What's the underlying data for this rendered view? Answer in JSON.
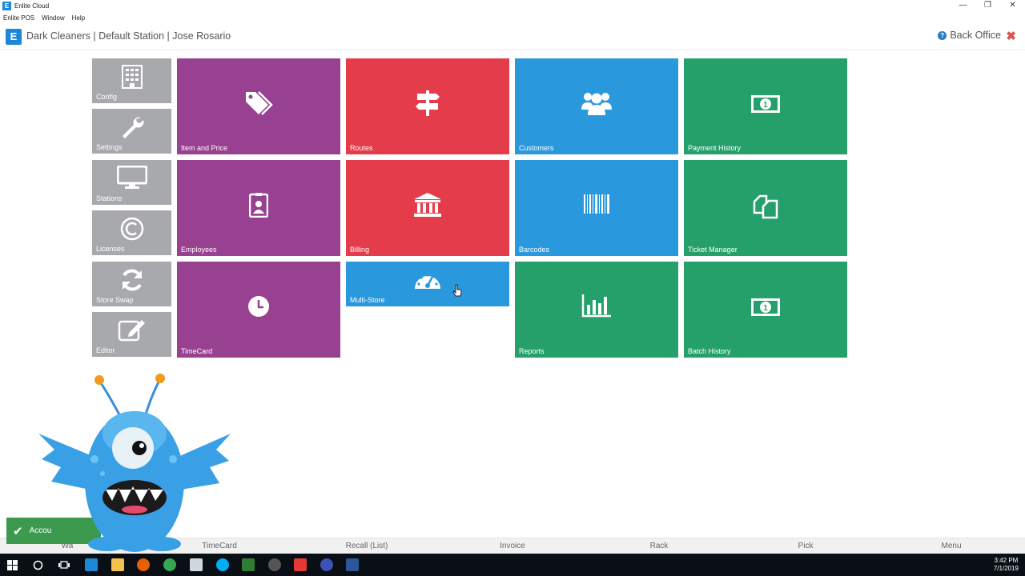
{
  "window": {
    "title": "Enlite Cloud",
    "app_icon_letter": "E",
    "controls": [
      "—",
      "❐",
      "✕"
    ]
  },
  "menubar": [
    "Enlite POS",
    "Window",
    "Help"
  ],
  "header": {
    "logo_letter": "E",
    "breadcrumb": "Dark Cleaners | Default Station | Jose Rosario",
    "back_office": "Back Office"
  },
  "tiles": {
    "config": "Config",
    "settings": "Settings",
    "stations": "Stations",
    "licenses": "Licenses",
    "store_swap": "Store Swap",
    "editor": "Editor",
    "item_and_price": "Item and Price",
    "employees": "Employees",
    "timecard": "TimeCard",
    "routes": "Routes",
    "billing": "Billing",
    "multi_store": "Multi-Store",
    "customers": "Customers",
    "barcodes": "Barcodes",
    "reports": "Reports",
    "payment_history": "Payment History",
    "ticket_manager": "Ticket Manager",
    "batch_history": "Batch History"
  },
  "toast": {
    "text": "Accou"
  },
  "bottombar": [
    "Wa",
    "TimeCard",
    "Recall (List)",
    "Invoice",
    "Rack",
    "Pick",
    "Menu"
  ],
  "clock": {
    "time": "3:42 PM",
    "date": "7/1/2019"
  },
  "colors": {
    "gray": "#a8a9ad",
    "purple": "#974190",
    "red": "#e43c4b",
    "blue": "#2a98dd",
    "green": "#26a06a"
  }
}
